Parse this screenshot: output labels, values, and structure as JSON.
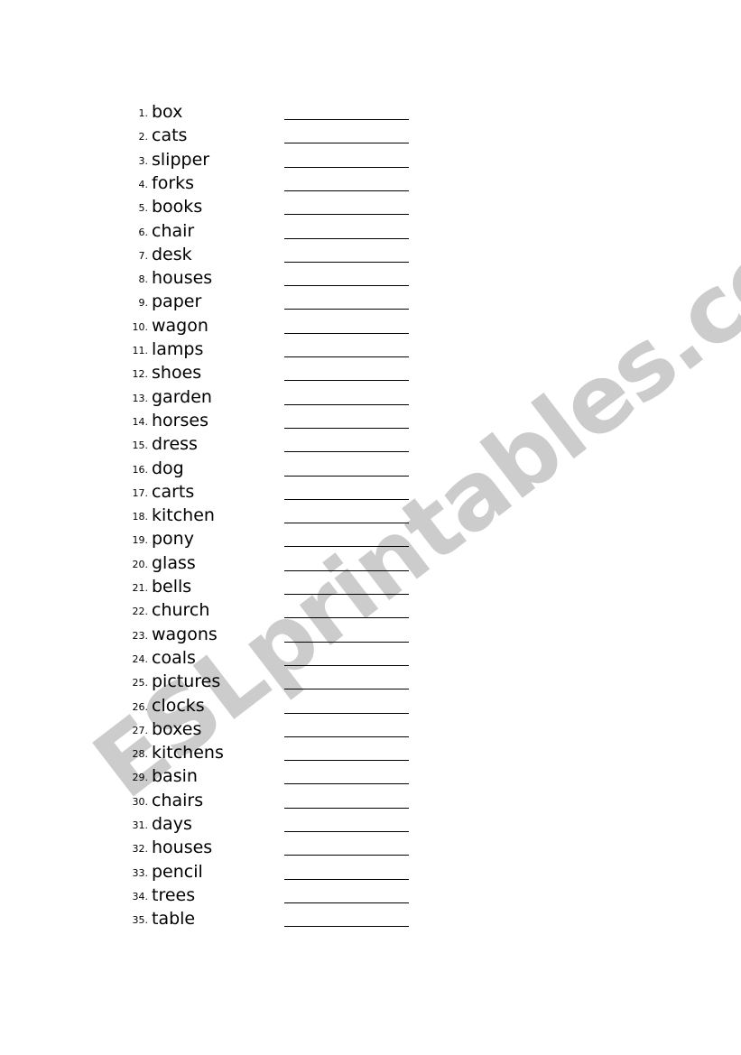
{
  "document": {
    "type": "worksheet",
    "watermark": "ESLprintables.com",
    "watermark_color": "#cccccc",
    "text_color": "#000000",
    "page_background": "#ffffff",
    "blank_line_color": "#000000"
  },
  "items": [
    {
      "number": "1.",
      "word": "box"
    },
    {
      "number": "2.",
      "word": "cats"
    },
    {
      "number": "3.",
      "word": "slipper"
    },
    {
      "number": "4.",
      "word": "forks"
    },
    {
      "number": "5.",
      "word": "books"
    },
    {
      "number": "6.",
      "word": "chair"
    },
    {
      "number": "7.",
      "word": "desk"
    },
    {
      "number": "8.",
      "word": "houses"
    },
    {
      "number": "9.",
      "word": "paper"
    },
    {
      "number": "10.",
      "word": "wagon"
    },
    {
      "number": "11.",
      "word": "lamps"
    },
    {
      "number": "12.",
      "word": "shoes"
    },
    {
      "number": "13.",
      "word": "garden"
    },
    {
      "number": "14.",
      "word": "horses"
    },
    {
      "number": "15.",
      "word": "dress"
    },
    {
      "number": "16.",
      "word": "dog"
    },
    {
      "number": "17.",
      "word": "carts"
    },
    {
      "number": "18.",
      "word": "kitchen"
    },
    {
      "number": "19.",
      "word": "pony"
    },
    {
      "number": "20.",
      "word": "glass"
    },
    {
      "number": "21.",
      "word": "bells"
    },
    {
      "number": "22.",
      "word": "church"
    },
    {
      "number": "23.",
      "word": "wagons"
    },
    {
      "number": "24.",
      "word": "coals"
    },
    {
      "number": "25.",
      "word": "pictures"
    },
    {
      "number": "26.",
      "word": "clocks"
    },
    {
      "number": "27.",
      "word": "boxes"
    },
    {
      "number": "28.",
      "word": "kitchens"
    },
    {
      "number": "29.",
      "word": "basin"
    },
    {
      "number": "30.",
      "word": "chairs"
    },
    {
      "number": "31.",
      "word": "days"
    },
    {
      "number": "32.",
      "word": "houses"
    },
    {
      "number": "33.",
      "word": "pencil"
    },
    {
      "number": "34.",
      "word": "trees"
    },
    {
      "number": "35.",
      "word": "table"
    }
  ]
}
